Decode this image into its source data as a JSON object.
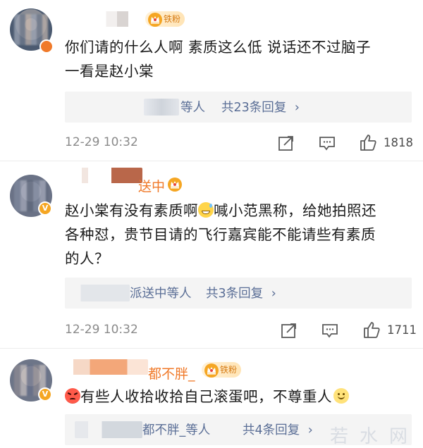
{
  "comments": [
    {
      "username_visible": "",
      "badge": "铁粉",
      "text_lines": [
        "你们请的什么人啊 素质这么低 说话还不过脑子",
        "一看是赵小棠"
      ],
      "replies": {
        "names": "等人",
        "count_text": "共23条回复",
        "chevron": "›"
      },
      "time": "12-29 10:32",
      "likes": "1818"
    },
    {
      "username_visible": "送中",
      "badge": "",
      "text_lines": [
        "赵小棠有没有素质啊",
        "喊小范黑称，给她拍照还",
        "各种怼，贵节目请的飞行嘉宾能不能请些有素质",
        "的人？"
      ],
      "replies": {
        "names": "派送中等人",
        "count_text": "共3条回复",
        "chevron": "›"
      },
      "time": "12-29 10:32",
      "likes": "1711"
    },
    {
      "username_visible": "都不胖_",
      "badge": "铁粉",
      "text_lines": [
        "有些人收拾收拾自己滚蛋吧，不尊重人"
      ],
      "replies": {
        "names": "都不胖_等人",
        "count_text": "共4条回复",
        "chevron": "›"
      },
      "time": "",
      "likes": ""
    }
  ],
  "watermark": "若水网",
  "icons": {
    "share": "share-icon",
    "comment": "comment-icon",
    "like": "like-icon",
    "crown": "crown-icon"
  },
  "colors": {
    "link_blue": "#5a6e96",
    "username_orange": "#f07a2a",
    "badge_gold": "#d67b14"
  }
}
